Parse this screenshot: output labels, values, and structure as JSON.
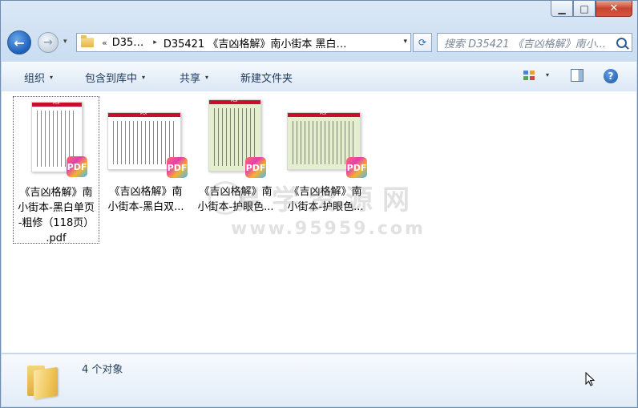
{
  "window": {
    "caption": {
      "minimize": "▁",
      "maximize": "□",
      "close": "✕"
    }
  },
  "nav": {
    "back_glyph": "←",
    "forward_glyph": "→",
    "history_glyph": "▾",
    "address": {
      "overflow": "«",
      "segment_short": "D35…",
      "arrow": "▸",
      "segment_current": "D35421 《吉凶格解》南小街本 黑白…",
      "dropdown": "▾"
    },
    "refresh_glyph": "⟳",
    "search_placeholder": "搜索 D35421 《吉凶格解》南小..."
  },
  "toolbar": {
    "organize": "组织",
    "include_in_library": "包含到库中",
    "share": "共享",
    "new_folder": "新建文件夹",
    "caret": "▾",
    "help": "?"
  },
  "files": [
    {
      "lines": [
        "《吉凶格解》南",
        "小街本-黑白单页",
        "-粗修（118页）",
        ".pdf"
      ],
      "selected": true,
      "tint": "#ffffff"
    },
    {
      "lines": [
        "《吉凶格解》南",
        "小街本-黑白双..."
      ],
      "selected": false,
      "tint": "#ffffff"
    },
    {
      "lines": [
        "《吉凶格解》南",
        "小街本-护眼色..."
      ],
      "selected": false,
      "tint": "#e4efcf"
    },
    {
      "lines": [
        "《吉凶格解》南",
        "小街本-护眼色..."
      ],
      "selected": false,
      "tint": "#e4efcf"
    }
  ],
  "thumb_header": "PDF",
  "pdf_badge": "PDF",
  "watermark": {
    "cn": "易学资源网",
    "url": "www.95959.com"
  },
  "details": {
    "count": "4 个对象"
  },
  "colors": {
    "pdf_red": "#c8102e",
    "accent_blue": "#1b5fb8"
  }
}
